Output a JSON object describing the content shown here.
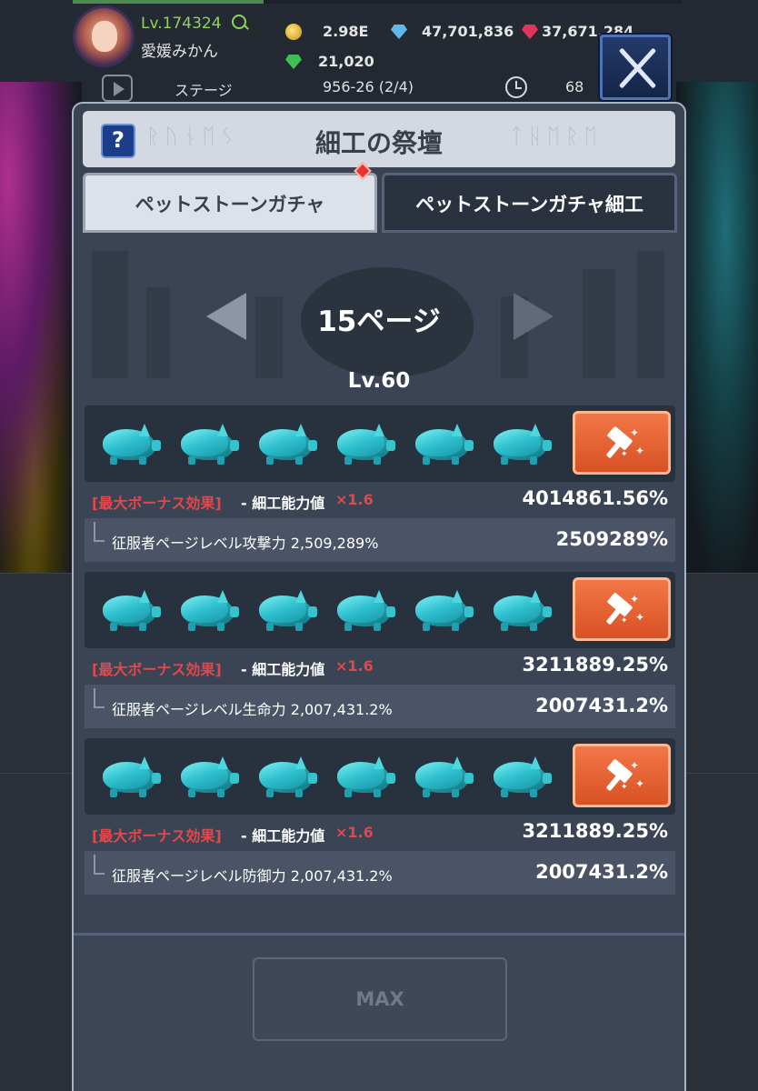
{
  "hud": {
    "level": "Lv.174324",
    "player_name": "愛媛みかん",
    "gold": "2.98E",
    "blue_gems": "47,701,836",
    "red_gems": "37,671,284",
    "green_gems": "21,020",
    "stage_label": "ステージ",
    "stage_value": "956-26 (2/4)",
    "timer": "68"
  },
  "modal": {
    "title": "細工の祭壇",
    "help_label": "?",
    "tabs": [
      {
        "label": "ペットストーンガチャ",
        "active": false
      },
      {
        "label": "ペットストーンガチャ細工",
        "active": true
      }
    ],
    "page_label": "15ページ",
    "level_label": "Lv.60",
    "crafts": [
      {
        "stones": 6,
        "bonus_tag": "[最大ボーナス効果]",
        "bonus_text": "- 細工能力値",
        "bonus_mult": "×1.6",
        "bonus_value": "4014861.56%",
        "stat_text": "征服者ページレベル攻撃力 2,509,289%",
        "stat_value": "2509289%"
      },
      {
        "stones": 6,
        "bonus_tag": "[最大ボーナス効果]",
        "bonus_text": "- 細工能力値",
        "bonus_mult": "×1.6",
        "bonus_value": "3211889.25%",
        "stat_text": "征服者ページレベル生命力 2,007,431.2%",
        "stat_value": "2007431.2%"
      },
      {
        "stones": 6,
        "bonus_tag": "[最大ボーナス効果]",
        "bonus_text": "- 細工能力値",
        "bonus_mult": "×1.6",
        "bonus_value": "3211889.25%",
        "stat_text": "征服者ページレベル防御力 2,007,431.2%",
        "stat_value": "2007431.2%"
      }
    ],
    "max_label": "MAX"
  },
  "colors": {
    "accent_orange": "#e2602f",
    "bonus_red": "#e0494b",
    "level_green": "#8fd35a",
    "stone_cyan": "#2ec0cf"
  },
  "icons": [
    "search-icon",
    "coin-icon",
    "blue-gem-icon",
    "red-gem-icon",
    "green-gem-icon",
    "play-icon",
    "clock-icon",
    "close-icon",
    "help-icon",
    "pet-stone-icon",
    "hammer-icon",
    "arrow-left-icon",
    "arrow-right-icon"
  ]
}
